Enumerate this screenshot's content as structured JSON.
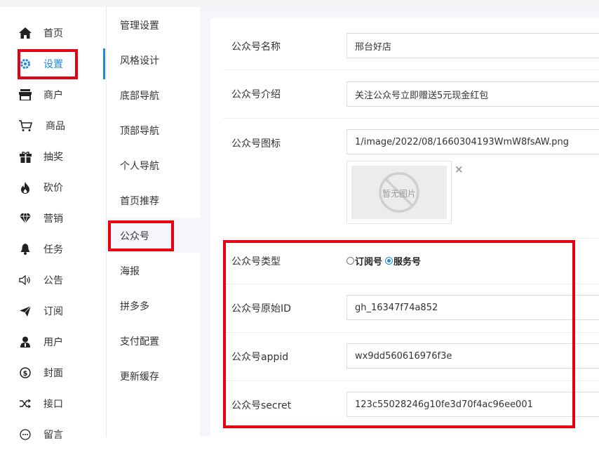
{
  "colors": {
    "accent": "#1e88e5",
    "highlight": "#e60012"
  },
  "main_nav": [
    {
      "label": "首页",
      "icon": "home-icon"
    },
    {
      "label": "设置",
      "icon": "gear-icon",
      "active": true
    },
    {
      "label": "商户",
      "icon": "store-icon"
    },
    {
      "label": "商品",
      "icon": "cart-icon"
    },
    {
      "label": "抽奖",
      "icon": "gift-icon"
    },
    {
      "label": "砍价",
      "icon": "fire-icon"
    },
    {
      "label": "营销",
      "icon": "diamond-icon"
    },
    {
      "label": "任务",
      "icon": "bell-icon"
    },
    {
      "label": "公告",
      "icon": "speaker-icon"
    },
    {
      "label": "订阅",
      "icon": "send-icon"
    },
    {
      "label": "用户",
      "icon": "user-icon"
    },
    {
      "label": "封面",
      "icon": "dollar-circle-icon"
    },
    {
      "label": "接口",
      "icon": "shuffle-icon"
    },
    {
      "label": "留言",
      "icon": "comment-icon"
    }
  ],
  "sub_nav": [
    {
      "label": "管理设置"
    },
    {
      "label": "风格设计"
    },
    {
      "label": "底部导航"
    },
    {
      "label": "顶部导航"
    },
    {
      "label": "个人导航"
    },
    {
      "label": "首页推荐"
    },
    {
      "label": "公众号",
      "active": true
    },
    {
      "label": "海报"
    },
    {
      "label": "拼多多"
    },
    {
      "label": "支付配置"
    },
    {
      "label": "更新缓存"
    }
  ],
  "form": {
    "name_label": "公众号名称",
    "name_value": "邢台好店",
    "intro_label": "公众号介绍",
    "intro_value": "关注公众号立即赠送5元现金红包",
    "icon_label": "公众号图标",
    "icon_value": "1/image/2022/08/1660304193WmW8fsAW.png",
    "no_image_text": "暂无图片",
    "close_glyph": "×",
    "type_label": "公众号类型",
    "type_options": [
      {
        "label": "订阅号",
        "checked": false
      },
      {
        "label": "服务号",
        "checked": true
      }
    ],
    "origin_id_label": "公众号原始ID",
    "origin_id_value": "gh_16347f74a852",
    "appid_label": "公众号appid",
    "appid_value": "wx9dd560616976f3e",
    "secret_label": "公众号secret",
    "secret_value": "123c55028246g10fe3d70f4ac96ee001"
  }
}
